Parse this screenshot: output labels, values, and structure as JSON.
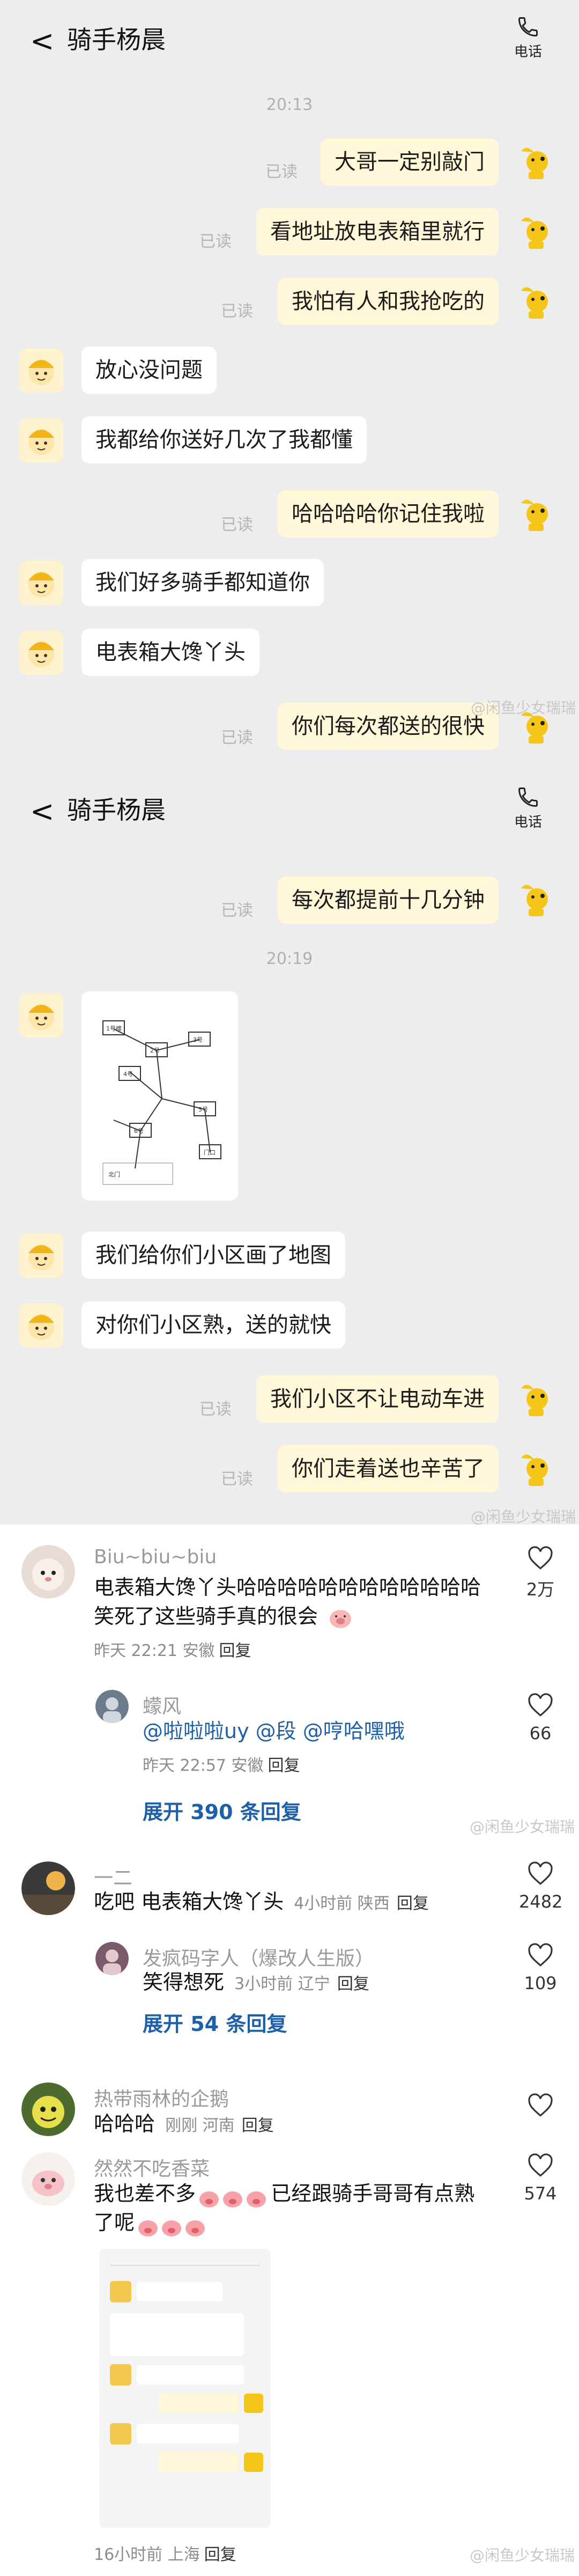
{
  "chat1": {
    "back": "<",
    "title": "骑手杨晨",
    "phone_label": "电话",
    "time": "20:13",
    "messages": [
      {
        "side": "out",
        "text": "大哥一定别敲门",
        "read": "已读"
      },
      {
        "side": "out",
        "text": "看地址放电表箱里就行",
        "read": "已读"
      },
      {
        "side": "out",
        "text": "我怕有人和我抢吃的",
        "read": "已读"
      },
      {
        "side": "in",
        "text": "放心没问题"
      },
      {
        "side": "in",
        "text": "我都给你送好几次了我都懂"
      },
      {
        "side": "out",
        "text": "哈哈哈哈你记住我啦",
        "read": "已读"
      },
      {
        "side": "in",
        "text": "我们好多骑手都知道你"
      },
      {
        "side": "in",
        "text": "电表箱大馋丫头"
      },
      {
        "side": "out",
        "text": "你们每次都送的很快",
        "read": "已读"
      }
    ],
    "watermark": "@闲鱼少女瑞瑞"
  },
  "chat2": {
    "back": "<",
    "title": "骑手杨晨",
    "phone_label": "电话",
    "first": {
      "text": "每次都提前十几分钟",
      "read": "已读"
    },
    "time": "20:19",
    "map_lines": [
      "1号楼",
      "2号",
      "3号",
      "4号",
      "5号",
      "6号",
      "门口",
      "北门"
    ],
    "messages": [
      {
        "side": "in",
        "text": "我们给你们小区画了地图"
      },
      {
        "side": "in",
        "text": "对你们小区熟，送的就快"
      },
      {
        "side": "out",
        "text": "我们小区不让电动车进",
        "read": "已读"
      },
      {
        "side": "out",
        "text": "你们走着送也辛苦了",
        "read": "已读"
      }
    ],
    "watermark": "@闲鱼少女瑞瑞"
  },
  "comments": {
    "c1": {
      "name": "Biu~biu~biu",
      "line1": "电表箱大馋丫头哈哈哈哈哈哈哈哈哈哈哈哈",
      "line2": "笑死了这些骑手真的很会",
      "meta_time": "昨天 22:21 安徽",
      "reply": "回复",
      "likes": "2万"
    },
    "r1": {
      "name": "蠓风",
      "mentions": "@啦啦啦uy @段 @哼哈嘿哦",
      "meta_time": "昨天 22:57 安徽",
      "reply": "回复",
      "likes": "66"
    },
    "expand1": "展开 390 条回复",
    "wm1": "@闲鱼少女瑞瑞",
    "c2": {
      "name": "一二",
      "text": "吃吧  电表箱大馋丫头",
      "meta_time": "4小时前 陕西",
      "reply": "回复",
      "likes": "2482"
    },
    "r2": {
      "name": "发疯码字人（爆改人生版）",
      "text": "笑得想死",
      "meta_time": "3小时前 辽宁",
      "reply": "回复",
      "likes": "109"
    },
    "expand2": "展开 54 条回复",
    "c3": {
      "name": "热带雨林的企鹅",
      "text": "哈哈哈",
      "meta_time": "刚刚 河南",
      "reply": "回复"
    },
    "c4": {
      "name": "然然不吃香菜",
      "line1": "我也差不多",
      "line1b": "已经跟骑手哥哥有点熟",
      "line2": "了呢",
      "meta_time": "16小时前 上海",
      "reply": "回复",
      "likes": "574"
    },
    "wm2": "@闲鱼少女瑞瑞"
  },
  "colors": {
    "out_bubble": "#fff7d8",
    "in_bubble": "#ffffff",
    "link": "#1d5fa9",
    "bg": "#ededed"
  }
}
